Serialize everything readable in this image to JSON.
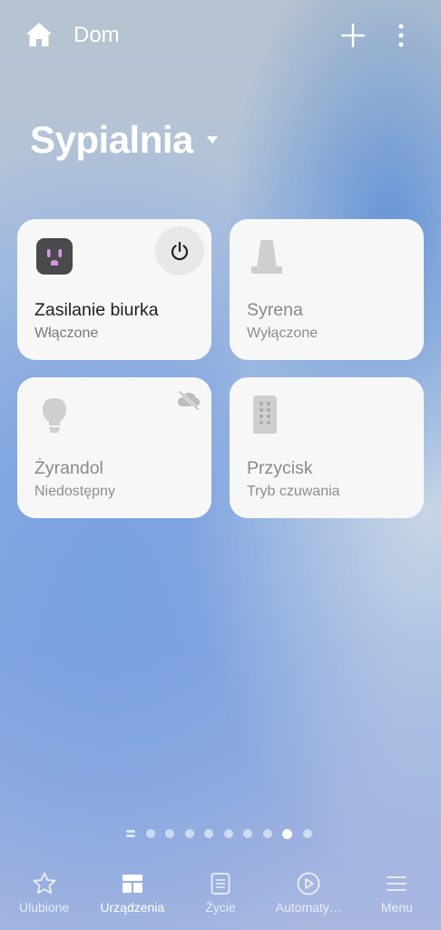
{
  "header": {
    "home_title": "Dom"
  },
  "room": {
    "title": "Sypialnia"
  },
  "devices": [
    {
      "name": "Zasilanie biurka",
      "status": "Włączone",
      "icon": "smart-plug-icon",
      "active": true
    },
    {
      "name": "Syrena",
      "status": "Wyłączone",
      "icon": "siren-icon",
      "active": false
    },
    {
      "name": "Żyrandol",
      "status": "Niedostępny",
      "icon": "light-bulb-icon",
      "active": false
    },
    {
      "name": "Przycisk",
      "status": "Tryb czuwania",
      "icon": "remote-button-icon",
      "active": false
    }
  ],
  "pager": {
    "pages": 9,
    "current": 8
  },
  "bottom_nav": [
    {
      "label": "Ulubione",
      "icon": "star-icon",
      "active": false
    },
    {
      "label": "Urządzenia",
      "icon": "devices-grid-icon",
      "active": true
    },
    {
      "label": "Życie",
      "icon": "life-card-icon",
      "active": false
    },
    {
      "label": "Automaty…",
      "icon": "play-circle-icon",
      "active": false
    },
    {
      "label": "Menu",
      "icon": "menu-icon",
      "active": false
    }
  ],
  "colors": {
    "card_bg": "#f7f7f8",
    "plug_icon_bg": "#4a4a4c",
    "plug_accent": "#d996e6",
    "inactive_icon": "#c8c8ca"
  }
}
